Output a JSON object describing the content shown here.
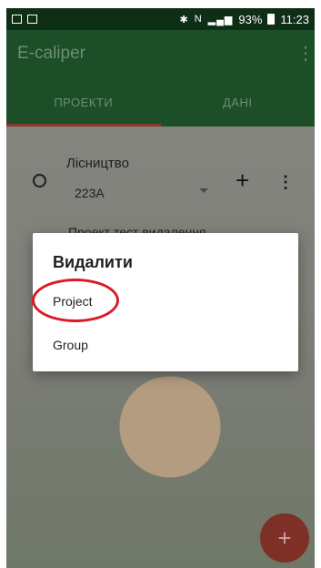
{
  "status_bar": {
    "battery": "93%",
    "time": "11:23",
    "icons": [
      "bluetooth-icon",
      "nfc-icon",
      "signal-icon",
      "battery-icon"
    ]
  },
  "app": {
    "title": "E-caliper",
    "toolbar_color": "#1c4f28"
  },
  "tabs": [
    {
      "label": "ПРОЕКТИ",
      "active": true
    },
    {
      "label": "ДАНІ",
      "active": false
    }
  ],
  "project": {
    "forestry_label": "Лісництво",
    "code": "223А",
    "title": "Проект тест видалення"
  },
  "dialog": {
    "title": "Видалити",
    "items": [
      "Project",
      "Group"
    ],
    "highlight_color": "#d81b24"
  },
  "fab": {
    "icon": "plus-icon",
    "label": "+"
  }
}
